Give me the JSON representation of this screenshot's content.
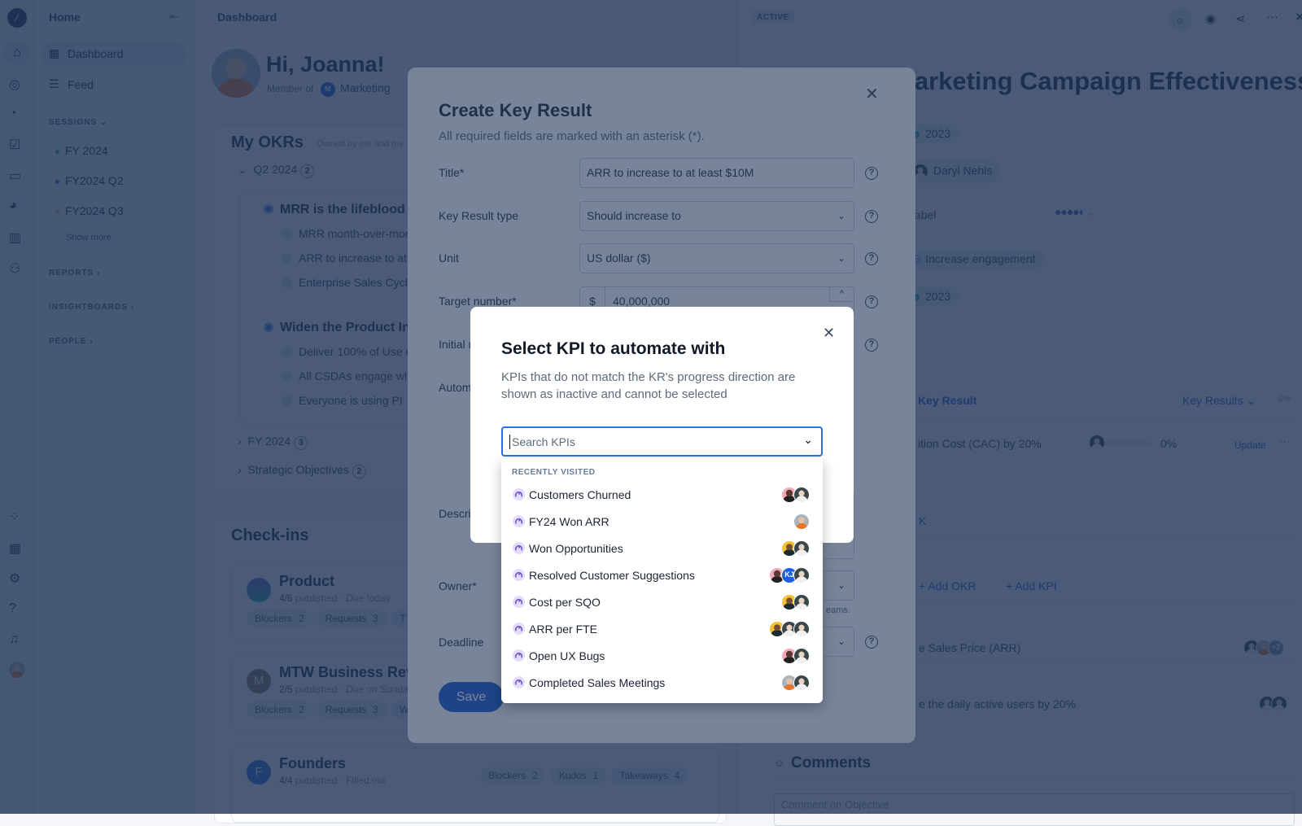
{
  "colors": {
    "accent": "#1f5fd1",
    "kpi_icon": "#7b5bd6",
    "session_fy2024": "#2bb3a0",
    "session_q2": "#2f6fe0",
    "session_q3": "#e8a33c"
  },
  "rail": {
    "icons": [
      "logo-icon",
      "home-icon",
      "target-icon",
      "gauge-icon",
      "checkbox-icon",
      "screen-icon",
      "pie-chart-icon",
      "bar-chart-icon",
      "people-icon",
      "apps-grid-icon",
      "add-widget-icon",
      "gear-icon",
      "help-icon",
      "bell-icon",
      "user-avatar"
    ]
  },
  "sidebar": {
    "title": "Home",
    "items": [
      {
        "label": "Dashboard",
        "icon": "table-icon",
        "active": true
      },
      {
        "label": "Feed",
        "icon": "feed-icon"
      }
    ],
    "sessions_label": "SESSIONS",
    "sessions": [
      {
        "label": "FY 2024",
        "color": "#2bb3a0"
      },
      {
        "label": "FY2024 Q2",
        "color": "#2f6fe0"
      },
      {
        "label": "FY2024 Q3",
        "color": "#e8a33c"
      }
    ],
    "show_more": "Show more",
    "reports_label": "REPORTS",
    "insightboards_label": "INSIGHTBOARDS",
    "people_label": "PEOPLE"
  },
  "main": {
    "header": "Dashboard",
    "greeting": "Hi, Joanna!",
    "member_of": "Member of",
    "team_initial": "M",
    "team": "Marketing",
    "okrs": {
      "title": "My OKRs",
      "subtitle": "Owned by me and my",
      "groups": [
        {
          "label": "Q2 2024",
          "count": "2"
        },
        {
          "label": "FY 2024",
          "count": "3"
        },
        {
          "label": "Strategic Objectives",
          "count": "2"
        }
      ],
      "objectives": [
        {
          "title": "MRR is the lifeblood of o",
          "krs": [
            "MRR month-over-month",
            "ARR to increase to at leas",
            "Enterprise Sales Cycle <"
          ]
        },
        {
          "title": "Widen the Product Intel",
          "krs": [
            "Deliver 100% of Use Cas",
            "All CSDAs engage with PI",
            "Everyone is using PI"
          ]
        }
      ]
    },
    "checkins": {
      "title": "Check-ins",
      "items": [
        {
          "name": "Product",
          "count": "4/6",
          "published": "published",
          "status": "· Due today",
          "tags": [
            {
              "label": "Blockers",
              "n": "2"
            },
            {
              "label": "Requests",
              "n": "3"
            },
            {
              "label": "T",
              "n": ""
            }
          ]
        },
        {
          "initial": "M",
          "name": "MTW Business Rev",
          "count": "2/5",
          "published": "published",
          "status": "· Due on Sunda",
          "tags": [
            {
              "label": "Blockers",
              "n": "2"
            },
            {
              "label": "Requests",
              "n": "3"
            },
            {
              "label": "W",
              "n": ""
            }
          ]
        },
        {
          "initial": "F",
          "name": "Founders",
          "count": "4/4",
          "published": "published",
          "status": "· Filled out",
          "tags": [
            {
              "label": "Blockers",
              "n": "2"
            },
            {
              "label": "Kudos",
              "n": "1"
            },
            {
              "label": "Takeaways",
              "n": "4"
            }
          ]
        }
      ]
    }
  },
  "panel": {
    "status": "ACTIVE",
    "toolbar_icons": [
      "sun-icon",
      "eye-icon",
      "share-icon",
      "more-icon",
      "close-icon"
    ],
    "title": "Marketing Campaign Effectiveness",
    "session1": "2023",
    "owner": "Daryl Nehls",
    "label_row": "Label",
    "confidence_level": 0.9,
    "parent": "Increase engagement",
    "session2": "2023",
    "add_kr": "Key Result",
    "kr_dropdown": "Key Results",
    "kr_progress": "0%",
    "kr_row": {
      "title": "ition Cost (CAC) by 20%",
      "progress": "0%",
      "progress_value": 0,
      "update": "Update"
    },
    "kpi_link": "K",
    "add_okr": "+ Add OKR",
    "add_kpi": "+ Add KPI",
    "aligned": [
      {
        "title": "e Sales Price (ARR)",
        "more": "+3"
      },
      {
        "title": "e the daily active users by 20%"
      }
    ],
    "comments_title": "Comments",
    "comment_placeholder": "Comment on Objective"
  },
  "create_kr": {
    "title": "Create Key Result",
    "subtitle": "All required fields are marked with an asterisk (*).",
    "fields": {
      "title_label": "Title*",
      "title_value": "ARR to increase to at least $10M",
      "type_label": "Key Result type",
      "type_value": "Should increase to",
      "unit_label": "Unit",
      "unit_value": "US dollar ($)",
      "target_label": "Target number*",
      "target_prefix": "$",
      "target_value": "40,000,000",
      "initial_label": "Initial r",
      "automation_label": "Autom",
      "description_label": "Descri",
      "owner_label": "Owner*",
      "owner_hint": "eams.",
      "deadline_label": "Deadline"
    },
    "save": "Save"
  },
  "kpi_dialog": {
    "title": "Select KPI to automate with",
    "description": "KPIs that do not match the KR's progress direction are shown as inactive and cannot be selected",
    "search_placeholder": "Search KPIs",
    "section": "RECENTLY VISITED",
    "items": [
      {
        "name": "Customers Churned",
        "owners": [
          "pink",
          "dark"
        ]
      },
      {
        "name": "FY24 Won ARR",
        "owners": [
          "gray"
        ]
      },
      {
        "name": "Won Opportunities",
        "owners": [
          "yellow",
          "dark"
        ]
      },
      {
        "name": "Resolved Customer Suggestions",
        "owners": [
          "pink",
          "KJ",
          "dark"
        ]
      },
      {
        "name": "Cost per SQO",
        "owners": [
          "yellow",
          "dark"
        ]
      },
      {
        "name": "ARR per FTE",
        "owners": [
          "yellow",
          "dark",
          "dark"
        ]
      },
      {
        "name": "Open UX Bugs",
        "owners": [
          "pink",
          "dark"
        ]
      },
      {
        "name": "Completed Sales Meetings",
        "owners": [
          "gray",
          "dark"
        ]
      }
    ]
  }
}
